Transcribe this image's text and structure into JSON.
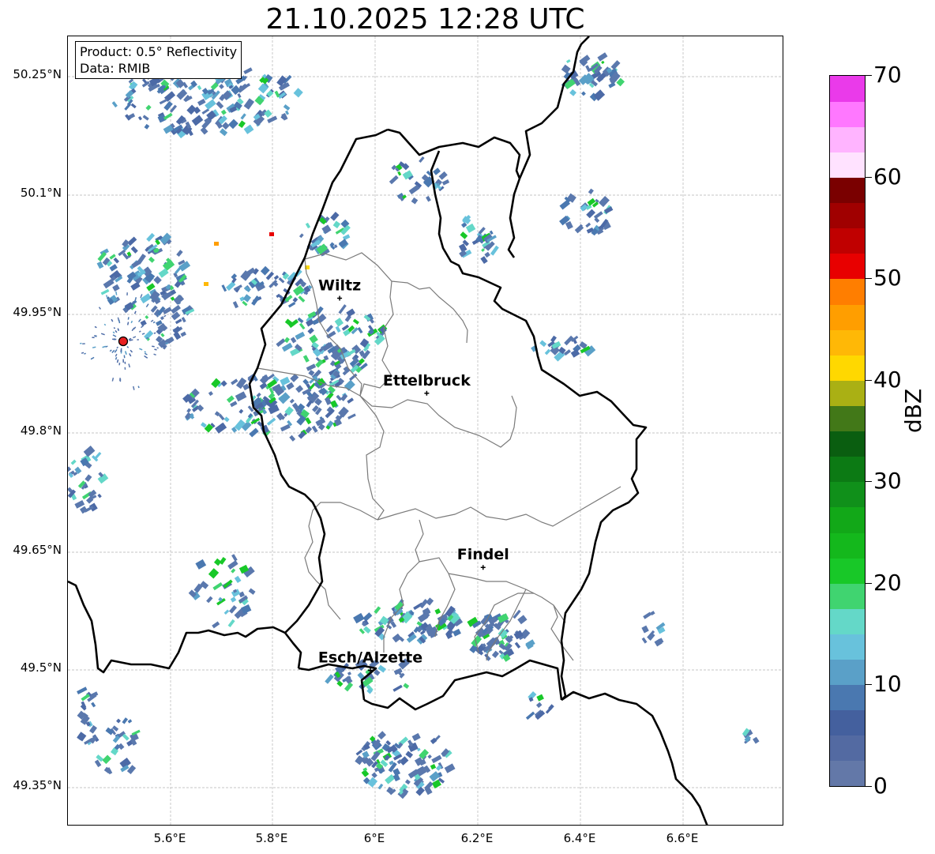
{
  "title": "21.10.2025 12:28 UTC",
  "info_box": {
    "product": "Product: 0.5° Reflectivity",
    "data": "Data: RMIB"
  },
  "latitude_labels": [
    "50.25°N",
    "50.1°N",
    "49.95°N",
    "49.8°N",
    "49.65°N",
    "49.5°N",
    "49.35°N"
  ],
  "longitude_labels": [
    "5.6°E",
    "5.8°E",
    "6°E",
    "6.2°E",
    "6.4°E",
    "6.6°E"
  ],
  "cities": [
    {
      "name": "Wiltz",
      "lat": 49.97,
      "lon": 5.93
    },
    {
      "name": "Ettelbruck",
      "lat": 49.85,
      "lon": 6.1
    },
    {
      "name": "Findel",
      "lat": 49.63,
      "lon": 6.21
    },
    {
      "name": "Esch/Alzette",
      "lat": 49.5,
      "lon": 5.99
    }
  ],
  "colorbar": {
    "label": "dBZ",
    "ticks": [
      "0",
      "10",
      "20",
      "30",
      "40",
      "50",
      "60",
      "70"
    ],
    "colors": [
      "#6378a8",
      "#536aa2",
      "#44609e",
      "#4a78b0",
      "#5aa0c8",
      "#68c2dc",
      "#64d8c8",
      "#40d470",
      "#18c828",
      "#14b81c",
      "#12a818",
      "#10901a",
      "#0c7a14",
      "#0a5e10",
      "#427818",
      "#aab014",
      "#ffd800",
      "#ffb806",
      "#ff9e00",
      "#ff7e00",
      "#e80000",
      "#c00000",
      "#a00000",
      "#7a0000",
      "#ffe2ff",
      "#ffb4ff",
      "#ff78ff",
      "#ea3aea"
    ]
  },
  "colors": {
    "country_border": "#000000",
    "district_border": "#7a7a7a",
    "grid": "#b4b4b4",
    "radar_site": "#e82020"
  }
}
